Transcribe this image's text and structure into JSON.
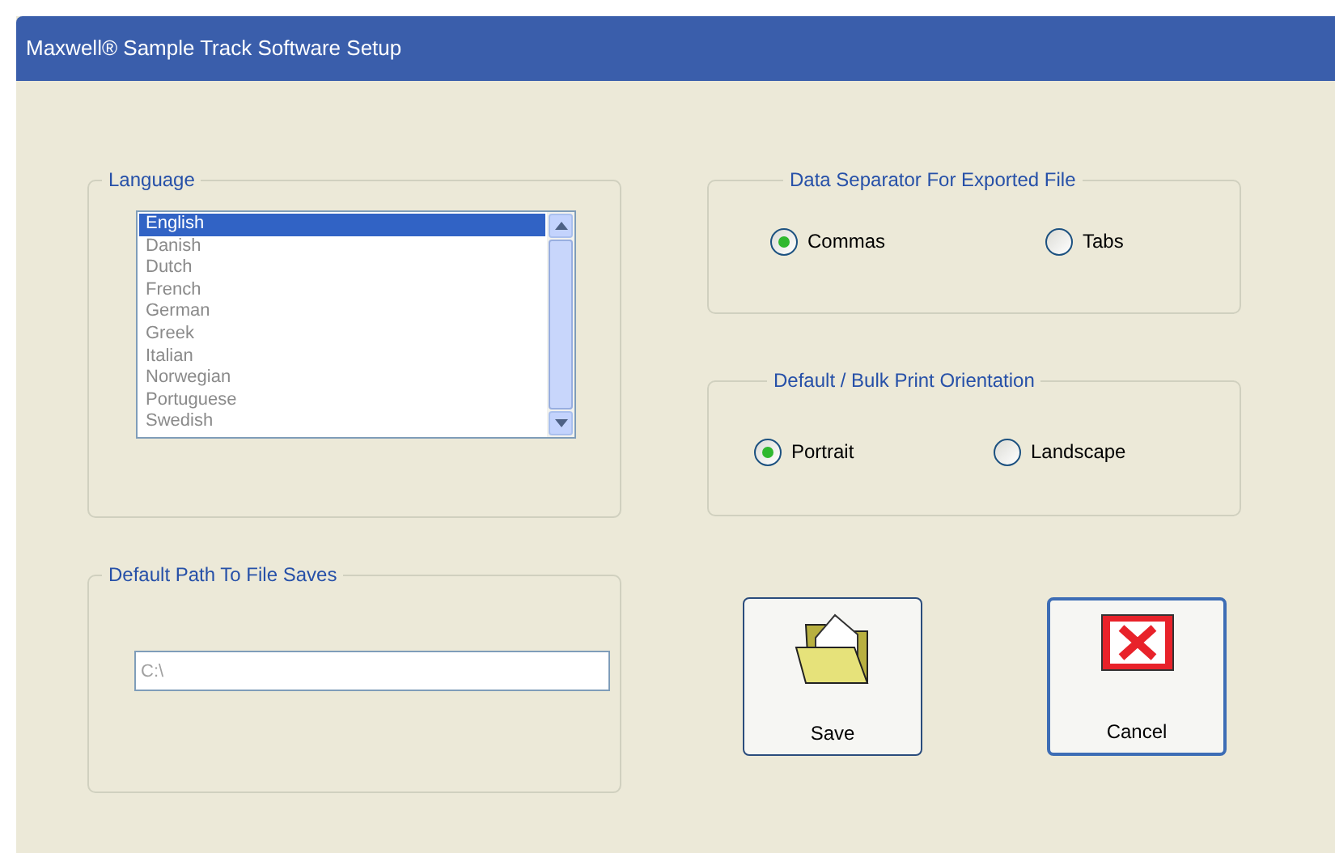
{
  "window": {
    "title": "Maxwell® Sample Track Software Setup"
  },
  "language": {
    "legend": "Language",
    "disabled": true,
    "items": [
      {
        "label": "English",
        "selected": true
      },
      {
        "label": "Danish",
        "selected": false
      },
      {
        "label": "Dutch",
        "selected": false
      },
      {
        "label": "French",
        "selected": false
      },
      {
        "label": "German",
        "selected": false
      },
      {
        "label": "Greek",
        "selected": false
      },
      {
        "label": "Italian",
        "selected": false
      },
      {
        "label": "Norwegian",
        "selected": false
      },
      {
        "label": "Portuguese",
        "selected": false
      },
      {
        "label": "Swedish",
        "selected": false
      }
    ]
  },
  "separator": {
    "legend": "Data Separator For Exported File",
    "options": [
      {
        "label": "Commas",
        "selected": true
      },
      {
        "label": "Tabs",
        "selected": false
      }
    ]
  },
  "orientation": {
    "legend": "Default / Bulk Print Orientation",
    "options": [
      {
        "label": "Portrait",
        "selected": true
      },
      {
        "label": "Landscape",
        "selected": false
      }
    ]
  },
  "path": {
    "legend": "Default Path To File Saves",
    "value": "C:\\",
    "disabled": true
  },
  "buttons": [
    {
      "kind": "save",
      "label": "Save"
    },
    {
      "kind": "cancel",
      "label": "Cancel"
    }
  ]
}
